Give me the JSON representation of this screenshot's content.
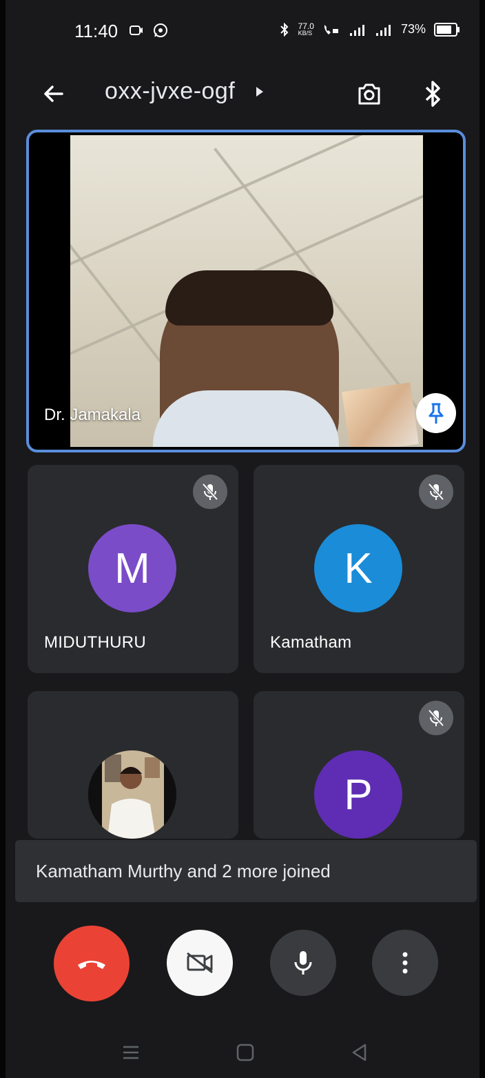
{
  "status_bar": {
    "time": "11:40",
    "network_speed_value": "77.0",
    "network_speed_unit": "KB/S",
    "battery_percent": "73%"
  },
  "top_bar": {
    "meeting_code": "oxx-jvxe-ogf"
  },
  "main_tile": {
    "participant_name": "Dr. Jamakala"
  },
  "participants": [
    {
      "name": "MIDUTHURU",
      "initial": "M",
      "muted": true,
      "color": "#7a4cc8"
    },
    {
      "name": "Kamatham",
      "initial": "K",
      "muted": true,
      "color": "#1a8cd8"
    },
    {
      "name": "",
      "initial": "",
      "muted": false,
      "photo": true
    },
    {
      "name": "",
      "initial": "P",
      "muted": true,
      "color": "#5e2db3"
    }
  ],
  "toast": {
    "text": "Kamatham Murthy and 2 more joined"
  },
  "colors": {
    "background": "#19191b",
    "tile": "#2a2b2e",
    "active_border": "#5a8edc",
    "end_call": "#ea4335"
  },
  "icons": [
    "back-arrow-icon",
    "switch-camera-icon",
    "bluetooth-icon",
    "pin-icon",
    "mic-off-icon",
    "end-call-icon",
    "camera-off-icon",
    "mic-icon",
    "more-vert-icon",
    "menu-icon",
    "home-icon",
    "back-icon"
  ]
}
